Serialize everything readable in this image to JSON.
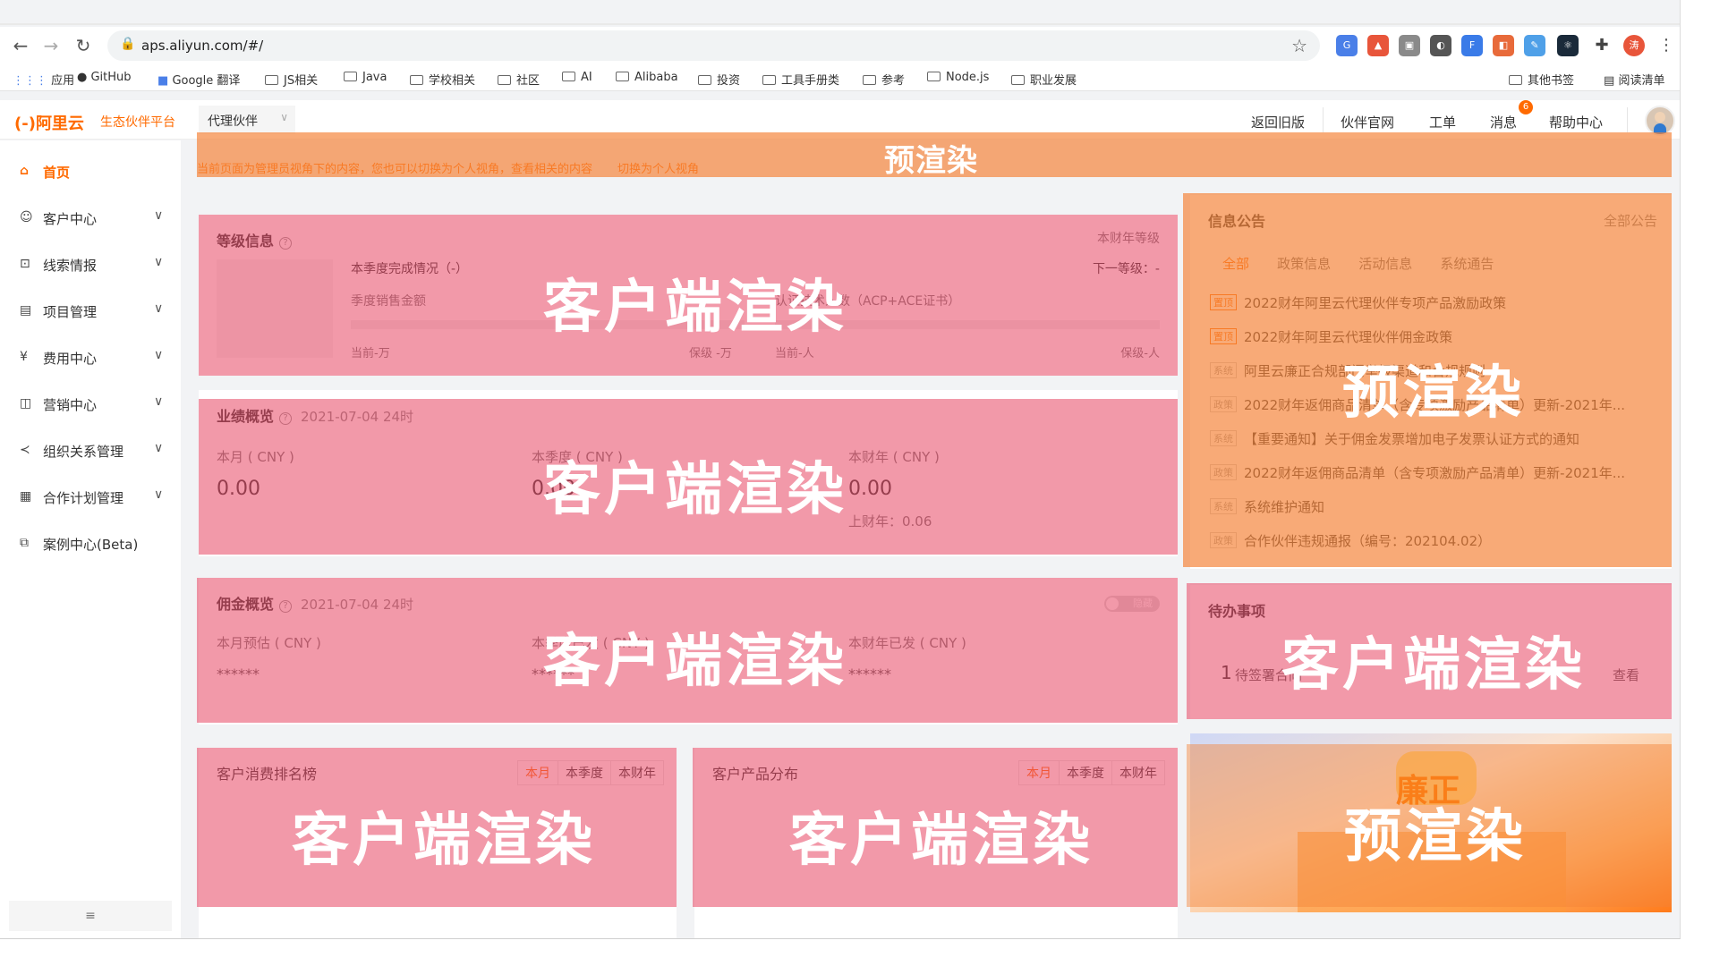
{
  "browser": {
    "url": "aps.aliyun.com/#/",
    "bookmarks": [
      "应用",
      "GitHub",
      "Google 翻译",
      "JS相关",
      "Java",
      "学校相关",
      "社区",
      "AI",
      "Alibaba",
      "投资",
      "工具手册类",
      "参考",
      "Node.js",
      "职业发展",
      "其他书签",
      "阅读清单"
    ]
  },
  "header": {
    "logo": "阿里云",
    "platform": "生态伙伴平台",
    "role": "代理伙伴",
    "nav": [
      "返回旧版",
      "伙伴官网",
      "工单",
      "消息",
      "帮助中心"
    ],
    "message_count": "6"
  },
  "sidebar": {
    "items": [
      {
        "label": "首页",
        "icon": "home-icon"
      },
      {
        "label": "客户中心",
        "icon": "customer-icon"
      },
      {
        "label": "线索情报",
        "icon": "lead-icon"
      },
      {
        "label": "项目管理",
        "icon": "project-icon"
      },
      {
        "label": "费用中心",
        "icon": "fee-icon"
      },
      {
        "label": "营销中心",
        "icon": "marketing-icon"
      },
      {
        "label": "组织关系管理",
        "icon": "org-icon"
      },
      {
        "label": "合作计划管理",
        "icon": "plan-icon"
      },
      {
        "label": "案例中心(Beta)",
        "icon": "case-icon"
      }
    ],
    "collapse": "≡"
  },
  "notice": {
    "text": "当前页面为管理员视角下的内容，您也可以切换为个人视角，查看相关的内容",
    "link": "切换为个人视角"
  },
  "level": {
    "title": "等级信息",
    "right": "本财年等级",
    "quarter": "本季度完成情况（-）",
    "next": "下一等级：-",
    "sales": "季度销售金额",
    "certified": "认证技术人数（ACP+ACE证书）",
    "current1": "当前-万",
    "keep1": "保级 -万",
    "current2": "当前-人",
    "keep2": "保级-人"
  },
  "performance": {
    "title": "业绩概览",
    "date": "2021-07-04 24时",
    "labels": [
      "本月 ( CNY )",
      "本季度 ( CNY )",
      "本财年 ( CNY )"
    ],
    "values": [
      "0.00",
      "0.00",
      "0.00"
    ],
    "last_year": "上财年：0.06"
  },
  "commission": {
    "title": "佣金概览",
    "date": "2021-07-04 24时",
    "toggle": "隐藏",
    "labels": [
      "本月预估 ( CNY )",
      "本季度已发 ( CNY )",
      "本财年已发 ( CNY )"
    ],
    "values": [
      "******",
      "******",
      "******"
    ]
  },
  "ranking": {
    "title": "客户消费排名榜",
    "periods": [
      "本月",
      "本季度",
      "本财年"
    ]
  },
  "distribution": {
    "title": "客户产品分布",
    "periods": [
      "本月",
      "本季度",
      "本财年"
    ]
  },
  "announcements": {
    "title": "信息公告",
    "all": "全部公告",
    "tabs": [
      "全部",
      "政策信息",
      "活动信息",
      "系统通告"
    ],
    "items": [
      {
        "tag": "置顶",
        "text": "2022财年阿里云代理伙伴专项产品激励政策"
      },
      {
        "tag": "置顶",
        "text": "2022财年阿里云代理伙伴佣金政策"
      },
      {
        "tag": "系统",
        "text": "阿里云廉正合规部门举报渠道和合规规则"
      },
      {
        "tag": "政策",
        "text": "2022财年返佣商品清单（含专项激励产品清单）更新-2021年..."
      },
      {
        "tag": "系统",
        "text": "【重要通知】关于佣金发票增加电子发票认证方式的通知"
      },
      {
        "tag": "政策",
        "text": "2022财年返佣商品清单（含专项激励产品清单）更新-2021年..."
      },
      {
        "tag": "系统",
        "text": "系统维护通知"
      },
      {
        "tag": "政策",
        "text": "合作伙伴违规通报（编号：202104.02）"
      }
    ]
  },
  "todo": {
    "title": "待办事项",
    "count": "1",
    "item": "待签署合同",
    "view": "查看"
  },
  "banner": {
    "title": "廉正"
  },
  "overlays": {
    "prerender": "预渲染",
    "client": "客户端渲染"
  }
}
